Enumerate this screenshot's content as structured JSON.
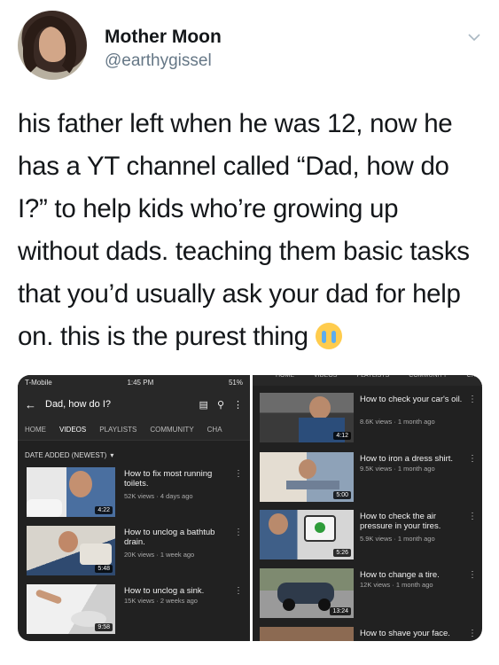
{
  "tweet": {
    "display_name": "Mother Moon",
    "handle": "@earthygissel",
    "text": "his father left when he was 12, now he has a YT channel called “Dad, how do I?” to help kids who’re growing up without dads. teaching them basic tasks that you’d usually ask your dad for help on. this is the purest thing",
    "emoji": "loudly-crying-face",
    "menu_icon": "chevron-down-icon"
  },
  "left_screenshot": {
    "status": {
      "carrier": "T-Mobile",
      "time": "1:45 PM",
      "battery": "51%"
    },
    "channel_title": "Dad, how do I?",
    "tabs": [
      "HOME",
      "VIDEOS",
      "PLAYLISTS",
      "COMMUNITY",
      "CHA"
    ],
    "active_tab": "VIDEOS",
    "sort_label": "DATE ADDED (NEWEST)",
    "videos": [
      {
        "title": "How to fix most running toilets.",
        "meta": "52K views · 4 days ago",
        "duration": "4:22"
      },
      {
        "title": "How to unclog a bathtub drain.",
        "meta": "20K views · 1 week ago",
        "duration": "5:48"
      },
      {
        "title": "How to unclog a sink.",
        "meta": "15K views · 2 weeks ago",
        "duration": "9:58"
      }
    ]
  },
  "right_screenshot": {
    "tabs": [
      "HOME",
      "VIDEOS",
      "PLAYLISTS",
      "COMMUNITY",
      "CH"
    ],
    "videos": [
      {
        "title": "How to check your car's oil.",
        "meta": "8.6K views · 1 month ago",
        "duration": "4:12"
      },
      {
        "title": "How to iron a dress shirt.",
        "meta": "9.5K views · 1 month ago",
        "duration": "5:00"
      },
      {
        "title": "How to check the air pressure in your tires.",
        "meta": "5.9K views · 1 month ago",
        "duration": "5:26"
      },
      {
        "title": "How to change a tire.",
        "meta": "12K views · 1 month ago",
        "duration": "13:24"
      },
      {
        "title": "How to shave your face.",
        "meta": "",
        "duration": ""
      }
    ]
  }
}
